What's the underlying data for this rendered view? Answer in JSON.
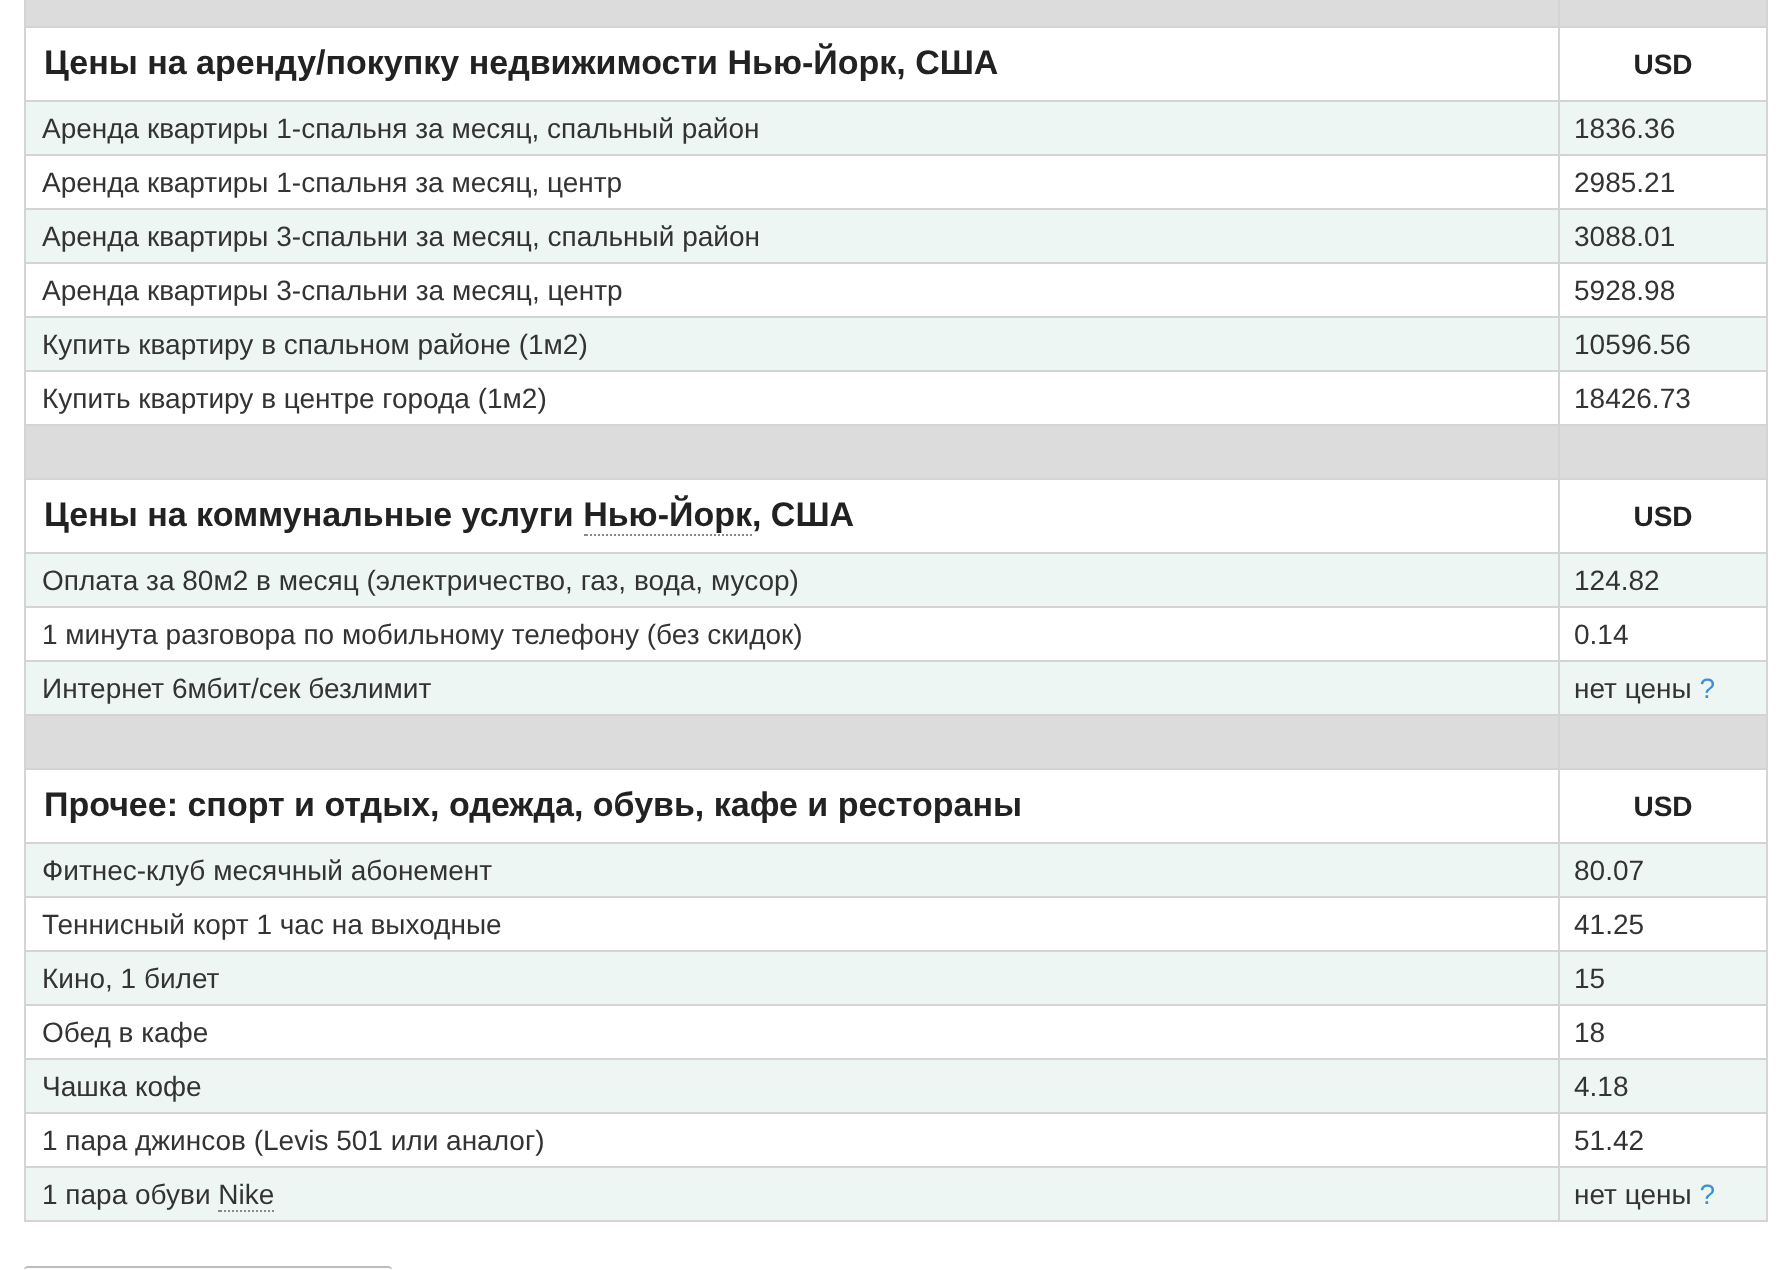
{
  "sections": [
    {
      "title_parts": [
        {
          "text": "Цены на аренду/покупку недвижимости Нью-Йорк, США"
        }
      ],
      "currency": "USD",
      "rows": [
        {
          "label_parts": [
            {
              "text": "Аренда квартиры 1-спальня за месяц, спальный район"
            }
          ],
          "value": "1836.36"
        },
        {
          "label_parts": [
            {
              "text": "Аренда квартиры 1-спальня за месяц, центр"
            }
          ],
          "value": "2985.21"
        },
        {
          "label_parts": [
            {
              "text": "Аренда квартиры 3-спальни за месяц, спальный район"
            }
          ],
          "value": "3088.01"
        },
        {
          "label_parts": [
            {
              "text": "Аренда квартиры 3-спальни за месяц, центр"
            }
          ],
          "value": "5928.98"
        },
        {
          "label_parts": [
            {
              "text": "Купить квартиру в спальном районе (1м2)"
            }
          ],
          "value": "10596.56"
        },
        {
          "label_parts": [
            {
              "text": "Купить квартиру в центре города (1м2)"
            }
          ],
          "value": "18426.73"
        }
      ]
    },
    {
      "title_parts": [
        {
          "text": "Цены на коммунальные услуги "
        },
        {
          "text": "Нью-Йорк",
          "link": true
        },
        {
          "text": ", США"
        }
      ],
      "currency": "USD",
      "rows": [
        {
          "label_parts": [
            {
              "text": "Оплата за 80м2 в месяц (электричество, газ, вода, мусор)"
            }
          ],
          "value": "124.82"
        },
        {
          "label_parts": [
            {
              "text": "1 минута разговора по мобильному телефону (без скидок)"
            }
          ],
          "value": "0.14"
        },
        {
          "label_parts": [
            {
              "text": "Интернет 6мбит/сек безлимит"
            }
          ],
          "value": "нет цены",
          "help": "?"
        }
      ]
    },
    {
      "title_parts": [
        {
          "text": "Прочее: спорт и отдых, одежда, обувь, кафе и рестораны"
        }
      ],
      "currency": "USD",
      "rows": [
        {
          "label_parts": [
            {
              "text": "Фитнес-клуб месячный абонемент"
            }
          ],
          "value": "80.07"
        },
        {
          "label_parts": [
            {
              "text": "Теннисный корт 1 час на выходные"
            }
          ],
          "value": "41.25"
        },
        {
          "label_parts": [
            {
              "text": "Кино, 1 билет"
            }
          ],
          "value": "15"
        },
        {
          "label_parts": [
            {
              "text": "Обед в кафе"
            }
          ],
          "value": "18"
        },
        {
          "label_parts": [
            {
              "text": "Чашка кофе"
            }
          ],
          "value": "4.18"
        },
        {
          "label_parts": [
            {
              "text": "1 пара джинсов (Levis 501 или аналог)"
            }
          ],
          "value": "51.42"
        },
        {
          "label_parts": [
            {
              "text": "1 пара обуви "
            },
            {
              "text": "Nike",
              "link": true
            }
          ],
          "value": "нет цены",
          "help": "?"
        }
      ]
    }
  ]
}
